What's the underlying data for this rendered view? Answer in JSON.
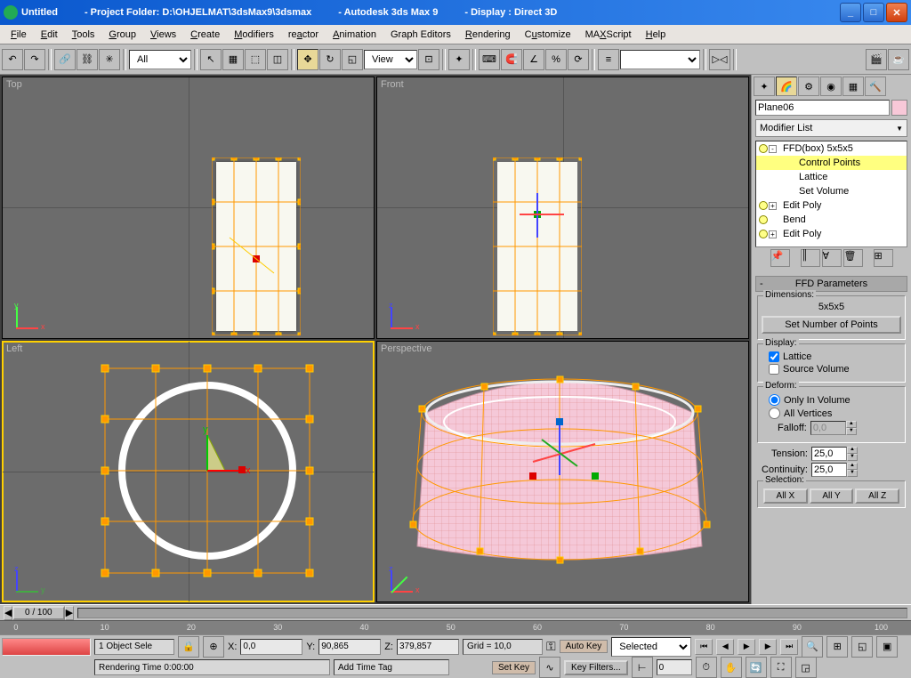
{
  "title": {
    "doc": "Untitled",
    "folder": "- Project Folder: D:\\OHJELMAT\\3dsMax9\\3dsmax",
    "app": "- Autodesk 3ds Max 9",
    "disp": "- Display : Direct 3D"
  },
  "menu": [
    "File",
    "Edit",
    "Tools",
    "Group",
    "Views",
    "Create",
    "Modifiers",
    "reactor",
    "Animation",
    "Graph Editors",
    "Rendering",
    "Customize",
    "MAXScript",
    "Help"
  ],
  "toolbar": {
    "set": "All",
    "viewmode": "View"
  },
  "viewports": {
    "tl": "Top",
    "tr": "Front",
    "bl": "Left",
    "br": "Perspective"
  },
  "panel": {
    "object": "Plane06",
    "modlist": "Modifier List",
    "stack": [
      {
        "label": "FFD(box) 5x5x5",
        "bulb": true,
        "exp": "-",
        "indent": 0,
        "sel": false
      },
      {
        "label": "Control Points",
        "indent": 1,
        "sel": true
      },
      {
        "label": "Lattice",
        "indent": 1,
        "sel": false
      },
      {
        "label": "Set Volume",
        "indent": 1,
        "sel": false
      },
      {
        "label": "Edit Poly",
        "bulb": true,
        "exp": "+",
        "indent": 0,
        "sel": false
      },
      {
        "label": "Bend",
        "bulb": true,
        "indent": 0,
        "sel": false
      },
      {
        "label": "Edit Poly",
        "bulb": true,
        "exp": "+",
        "indent": 0,
        "sel": false
      }
    ],
    "rollout": "FFD Parameters",
    "dims_label": "Dimensions:",
    "dims": "5x5x5",
    "setpts": "Set Number of Points",
    "disp_label": "Display:",
    "lattice": "Lattice",
    "srcvol": "Source Volume",
    "deform_label": "Deform:",
    "only": "Only In Volume",
    "allv": "All Vertices",
    "falloff_label": "Falloff:",
    "falloff": "0,0",
    "tension_label": "Tension:",
    "tension": "25,0",
    "cont_label": "Continuity:",
    "cont": "25,0",
    "sel_label": "Selection:",
    "allx": "All X",
    "ally": "All Y",
    "allz": "All Z"
  },
  "status": {
    "frame": "0 / 100",
    "ticks": [
      "0",
      "10",
      "20",
      "30",
      "40",
      "50",
      "60",
      "70",
      "80",
      "90",
      "100"
    ],
    "objsel": "1 Object Sele",
    "x": "0,0",
    "y": "90,865",
    "z": "379,857",
    "grid": "Grid = 10,0",
    "autokey": "Auto Key",
    "setkey": "Set Key",
    "selected": "Selected",
    "keyfilters": "Key Filters...",
    "rendertime": "Rendering Time  0:00:00",
    "addtag": "Add Time Tag",
    "curframe": "0"
  }
}
